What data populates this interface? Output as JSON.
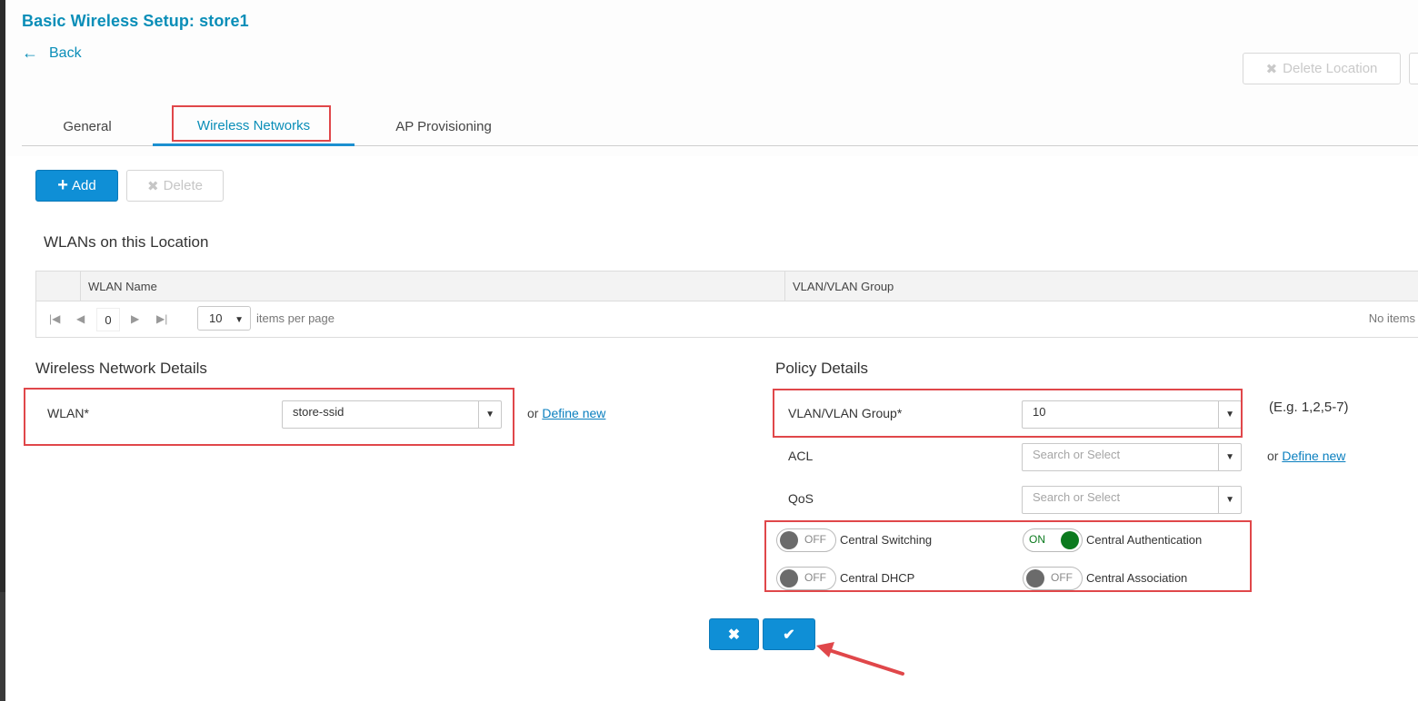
{
  "header": {
    "title": "Basic Wireless Setup: store1",
    "back_label": "Back",
    "back_arrow": "←",
    "delete_location_label": "Delete Location"
  },
  "tabs": [
    {
      "label": "General"
    },
    {
      "label": "Wireless Networks",
      "active": true
    },
    {
      "label": "AP Provisioning"
    }
  ],
  "toolbar": {
    "add_label": "Add",
    "add_glyph": "+",
    "delete_label": "Delete",
    "delete_glyph": "✖"
  },
  "wlans": {
    "section_title": "WLANs on this Location",
    "columns": [
      "WLAN Name",
      "VLAN/VLAN Group"
    ],
    "pager": {
      "page": "0",
      "page_size": "10",
      "items_per_page_label": "items per page",
      "empty_label": "No items"
    }
  },
  "wireless_details": {
    "section_title": "Wireless Network Details",
    "wlan_label": "WLAN*",
    "wlan_value": "store-ssid",
    "or_label": "or",
    "define_new_label": "Define new"
  },
  "policy": {
    "section_title": "Policy Details",
    "vlan_label": "VLAN/VLAN Group*",
    "vlan_value": "10",
    "vlan_hint": "(E.g. 1,2,5-7)",
    "acl_label": "ACL",
    "acl_placeholder": "Search or Select",
    "qos_label": "QoS",
    "qos_placeholder": "Search or Select",
    "or_label": "or",
    "define_new_label": "Define new",
    "toggles": [
      {
        "label": "Central Switching",
        "state": "OFF"
      },
      {
        "label": "Central Authentication",
        "state": "ON"
      },
      {
        "label": "Central DHCP",
        "state": "OFF"
      },
      {
        "label": "Central Association",
        "state": "OFF"
      }
    ]
  },
  "actions": {
    "cancel_glyph": "✖",
    "confirm_glyph": "✔"
  },
  "colors": {
    "accent": "#0a8eb8",
    "primary_button": "#0f8fd6",
    "highlight": "#e0474a",
    "toggle_on": "#0b7a1e"
  }
}
